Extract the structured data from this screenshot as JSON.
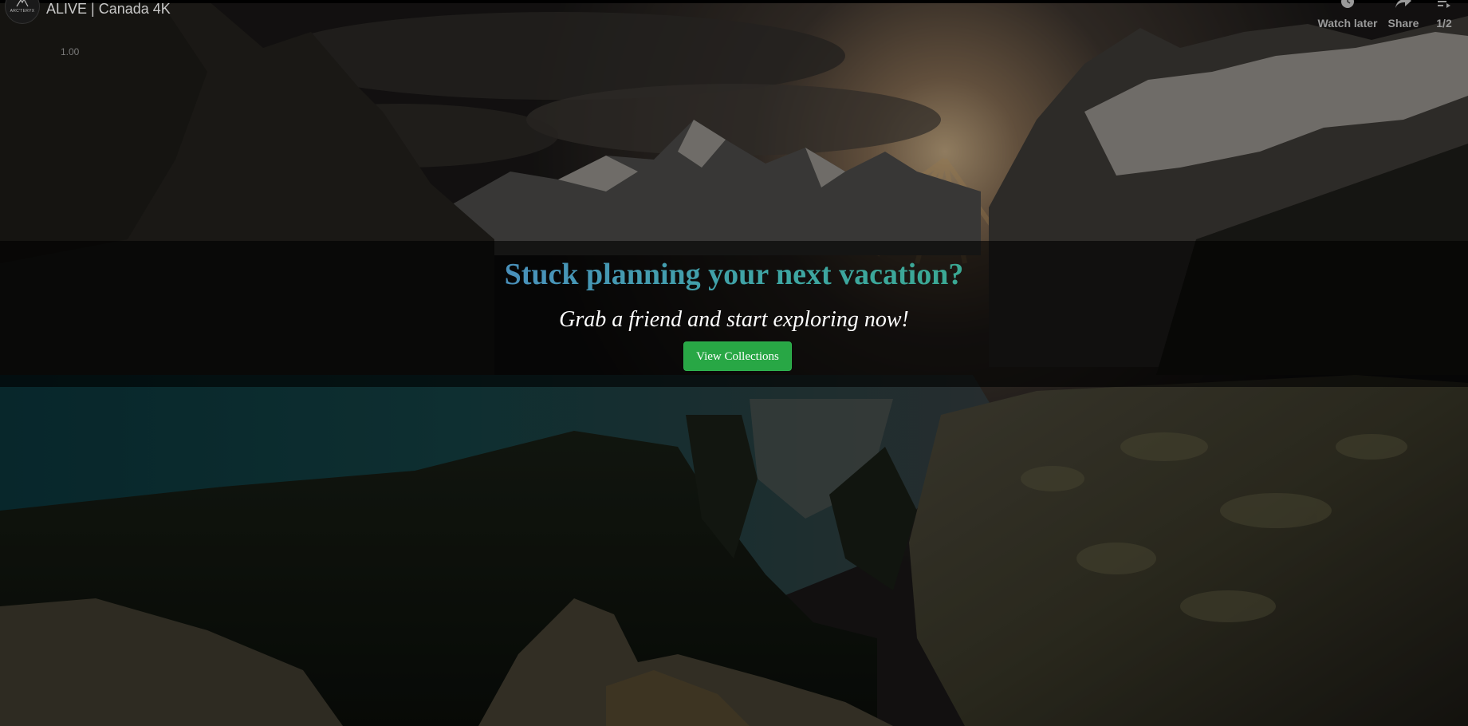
{
  "video": {
    "title": "ALIVE | Canada 4K",
    "channel_logo_text": "ARC'TERYX",
    "speed_badge": "1.00"
  },
  "player_actions": [
    {
      "label": "Watch later",
      "icon": "clock-icon"
    },
    {
      "label": "Share",
      "icon": "share-arrow-icon"
    },
    {
      "label": "1/2",
      "icon": "playlist-icon"
    }
  ],
  "hero": {
    "title": "Stuck planning your next vacation?",
    "subtitle": "Grab a friend and start exploring now!",
    "cta_label": "View Collections"
  },
  "colors": {
    "cta_background": "#28a745",
    "title_gradient_start": "#4a8fbd",
    "title_gradient_end": "#3aa891",
    "overlay": "rgba(0,0,0,0.62)"
  }
}
